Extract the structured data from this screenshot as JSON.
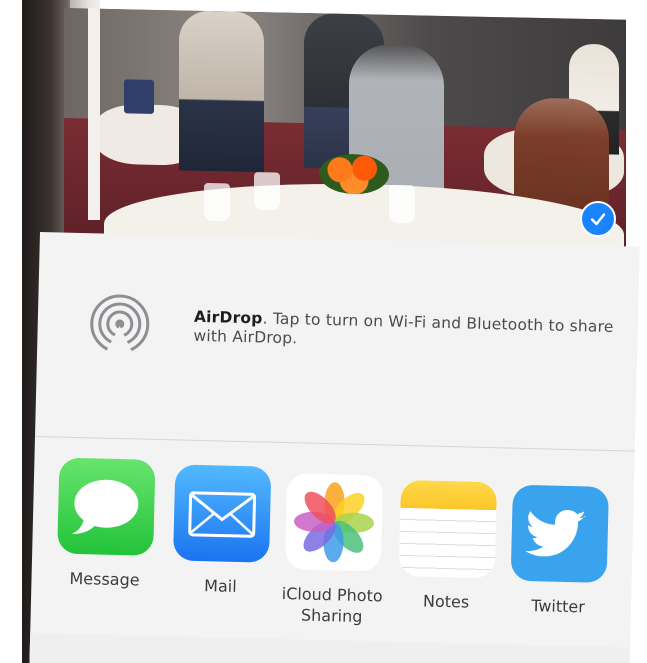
{
  "photo": {
    "selected": true,
    "check_color": "#1a84ff"
  },
  "share_sheet": {
    "airdrop": {
      "title": "AirDrop",
      "message_line1": ". Tap to turn on Wi-Fi and Bluetooth to share",
      "message_line2": "with AirDrop.",
      "icon": "airdrop-icon"
    },
    "apps": [
      {
        "label": "Message",
        "icon": "message-icon",
        "color": "#2ac940"
      },
      {
        "label": "Mail",
        "icon": "mail-icon",
        "color": "#1f7ef4"
      },
      {
        "label_line1": "iCloud Photo",
        "label_line2": "Sharing",
        "icon": "photos-icon"
      },
      {
        "label": "Notes",
        "icon": "notes-icon",
        "color": "#fbcc33"
      },
      {
        "label": "Twitter",
        "icon": "twitter-bird-icon",
        "color": "#3aa3ee"
      }
    ]
  }
}
